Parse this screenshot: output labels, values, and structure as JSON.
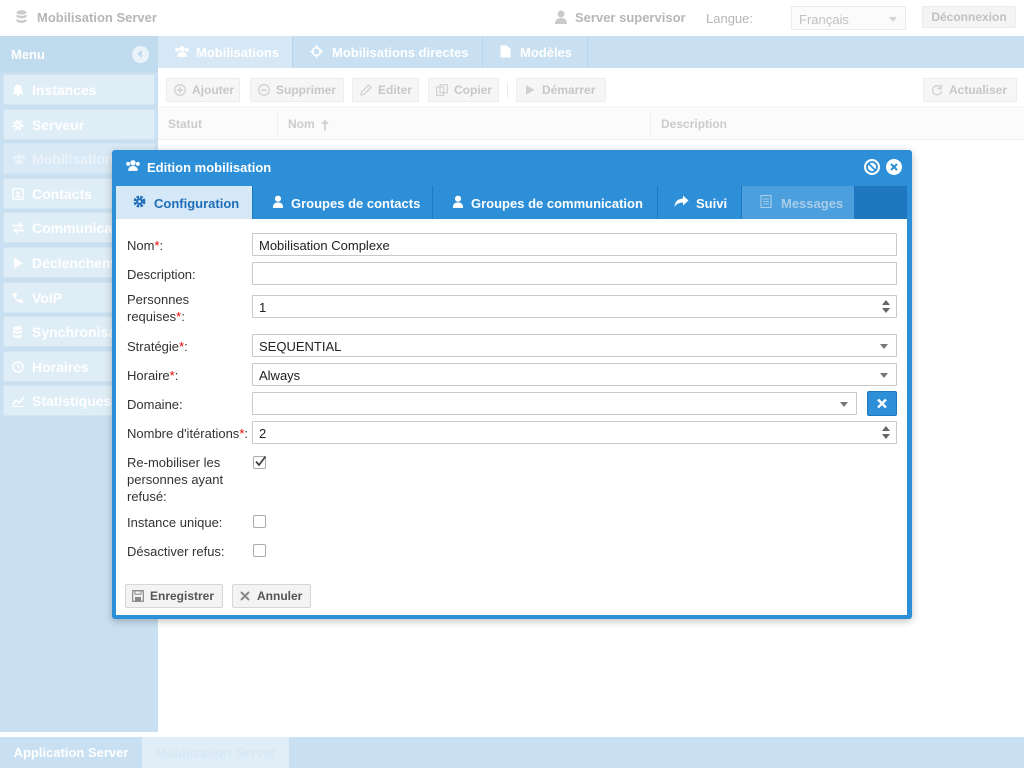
{
  "app": {
    "title": "Mobilisation Server",
    "user": "Server supervisor",
    "language_label": "Langue:",
    "language_value": "Français",
    "logout": "Déconnexion"
  },
  "sidebar": {
    "header": "Menu",
    "items": [
      {
        "label": "Instances",
        "icon": "bell-icon"
      },
      {
        "label": "Serveur",
        "icon": "gear-icon"
      },
      {
        "label": "Mobilisations",
        "icon": "users-icon"
      },
      {
        "label": "Contacts",
        "icon": "address-book-icon"
      },
      {
        "label": "Communications",
        "icon": "exchange-icon"
      },
      {
        "label": "Déclenchements",
        "icon": "play-icon"
      },
      {
        "label": "VoIP",
        "icon": "phone-icon"
      },
      {
        "label": "Synchronisation",
        "icon": "database-icon"
      },
      {
        "label": "Horaires",
        "icon": "clock-icon"
      },
      {
        "label": "Statistiques",
        "icon": "chart-icon"
      }
    ]
  },
  "main_tabs": [
    {
      "label": "Mobilisations",
      "icon": "users-icon"
    },
    {
      "label": "Mobilisations directes",
      "icon": "crosshair-icon"
    },
    {
      "label": "Modèles",
      "icon": "document-icon"
    }
  ],
  "toolbar": {
    "add": "Ajouter",
    "delete": "Supprimer",
    "edit": "Editer",
    "copy": "Copier",
    "start": "Démarrer",
    "refresh": "Actualiser"
  },
  "grid": {
    "columns": [
      "Statut",
      "Nom",
      "Description"
    ]
  },
  "dialog": {
    "title": "Edition mobilisation",
    "tabs": [
      {
        "label": "Configuration",
        "icon": "gear-icon"
      },
      {
        "label": "Groupes de contacts",
        "icon": "user-icon"
      },
      {
        "label": "Groupes de communication",
        "icon": "user-icon"
      },
      {
        "label": "Suivi",
        "icon": "share-icon"
      },
      {
        "label": "Messages",
        "icon": "document-icon"
      }
    ],
    "fields": {
      "name": {
        "label": "Nom",
        "required": "*",
        "suffix": ":",
        "value": "Mobilisation Complexe"
      },
      "description": {
        "label": "Description:",
        "value": ""
      },
      "persons": {
        "label_1": "Personnes",
        "label_2": "requises",
        "required": "*",
        "suffix": ":",
        "value": "1"
      },
      "strategy": {
        "label": "Stratégie",
        "required": "*",
        "suffix": ":",
        "value": "SEQUENTIAL"
      },
      "schedule": {
        "label": "Horaire",
        "required": "*",
        "suffix": ":",
        "value": "Always"
      },
      "domain": {
        "label": "Domaine:",
        "value": ""
      },
      "iterations": {
        "label": "Nombre d'itérations",
        "required": "*",
        "suffix": ":",
        "value": "2"
      },
      "remobilise": {
        "label_1": "Re-mobiliser les",
        "label_2": "personnes ayant",
        "label_3": "refusé:",
        "checked": true
      },
      "unique": {
        "label": "Instance unique:",
        "checked": false
      },
      "disable_refusal": {
        "label": "Désactiver refus:",
        "checked": false
      }
    },
    "save": "Enregistrer",
    "cancel": "Annuler"
  },
  "bottom_tabs": [
    "Application Server",
    "Mobilisation Server"
  ],
  "colors": {
    "accent": "#2c8fd8",
    "accent_dark": "#1f78bf",
    "sidebar": "#b3d4ec",
    "required": "#e00000"
  }
}
